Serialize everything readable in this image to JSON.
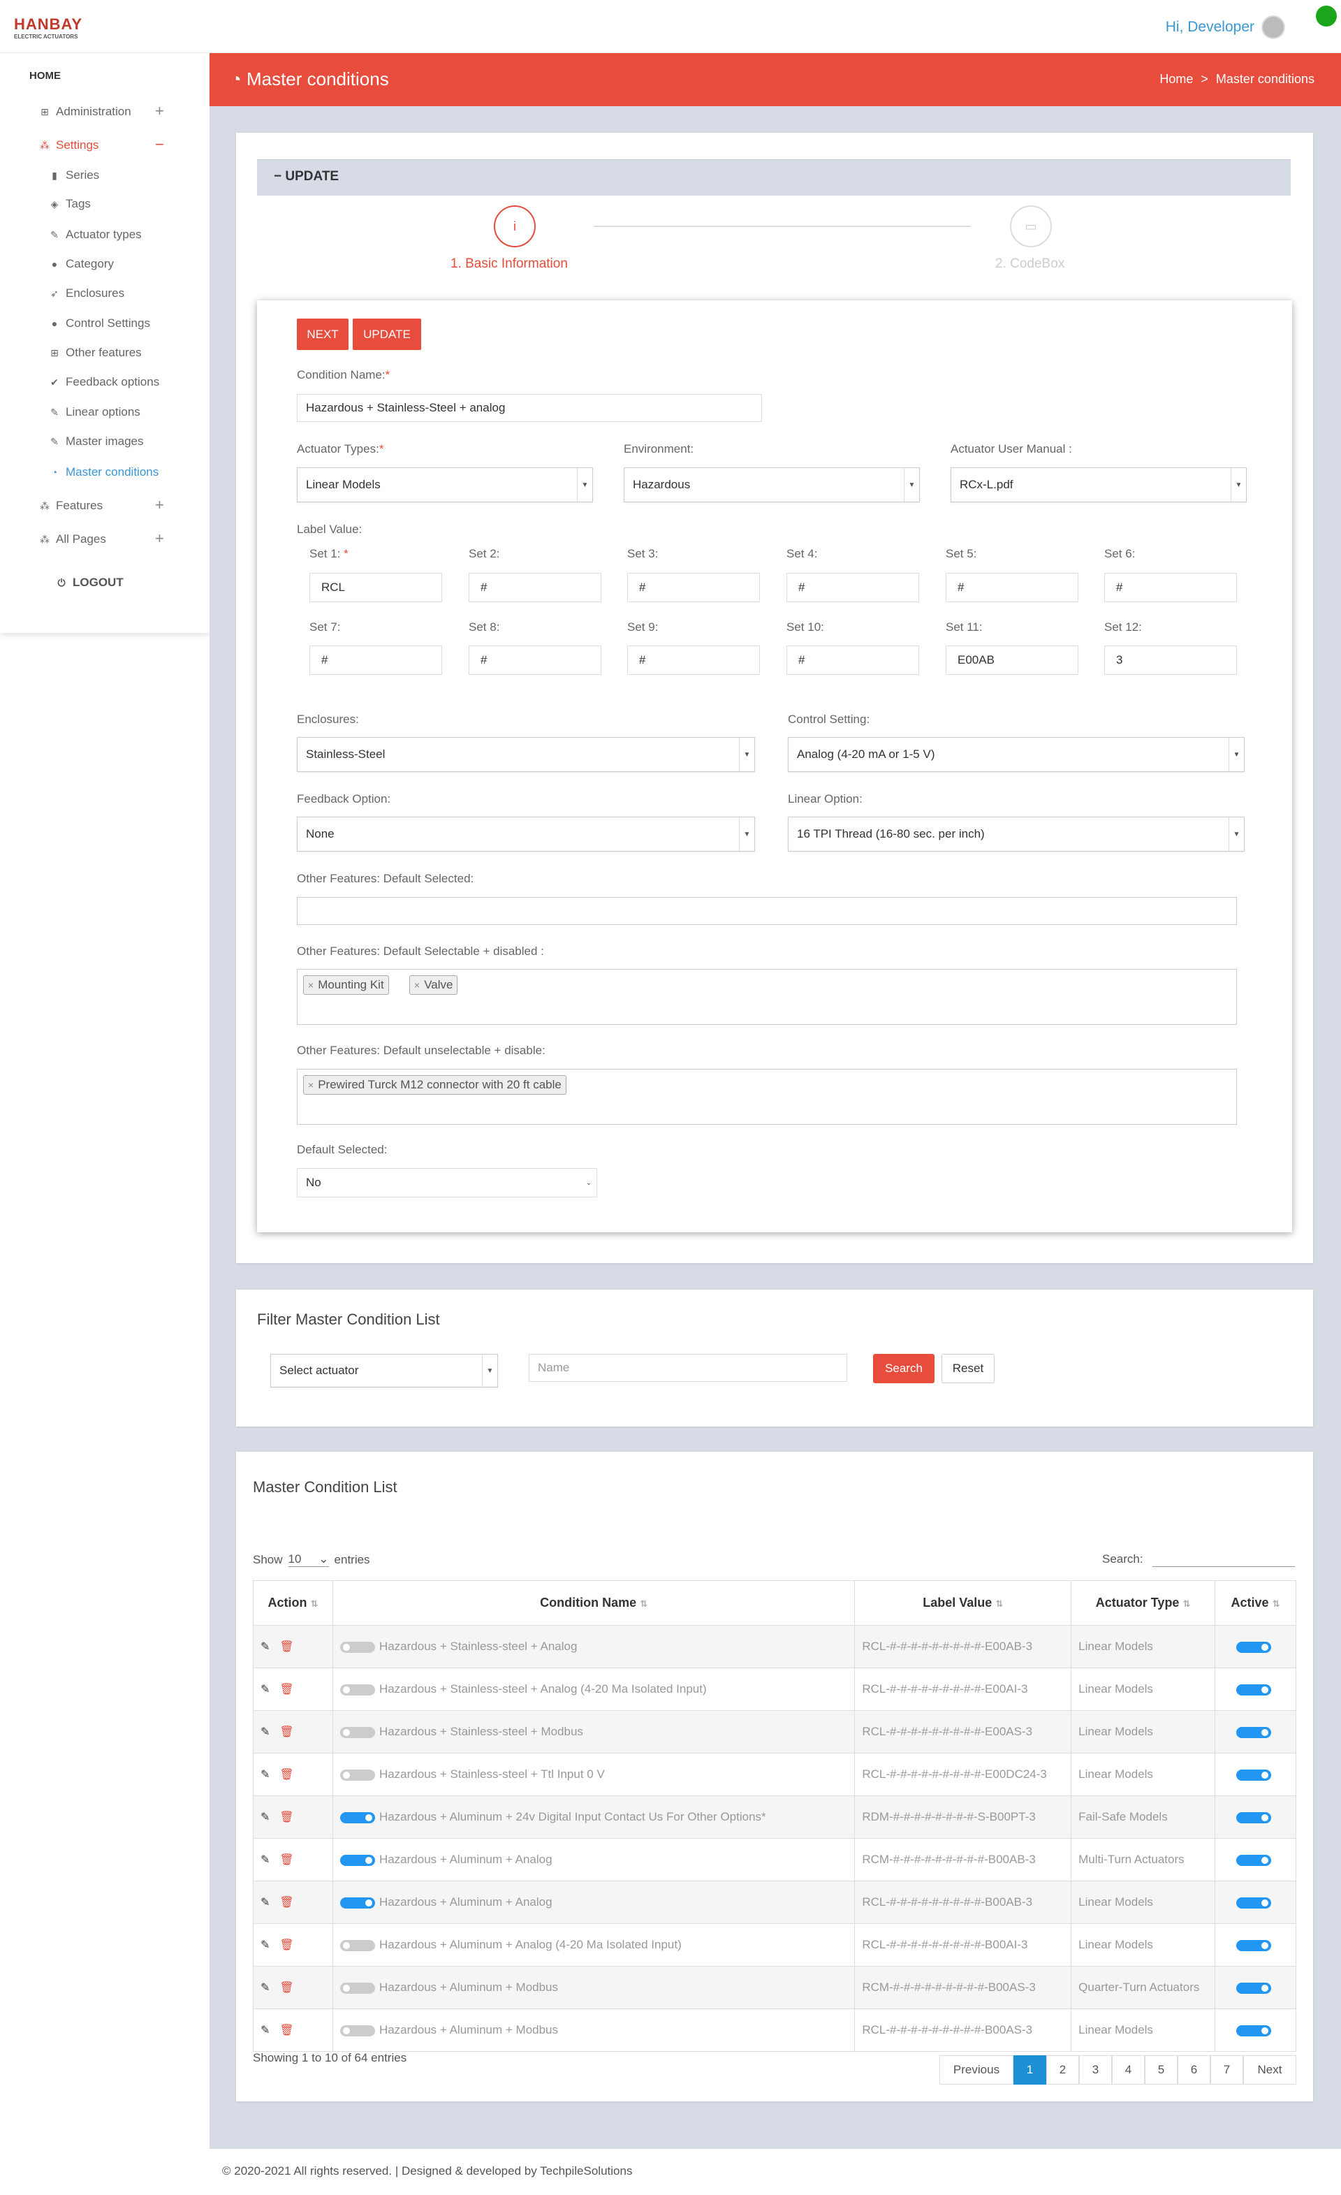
{
  "brand": {
    "name": "HANBAY",
    "tagline": "ELECTRIC ACTUATORS"
  },
  "user": {
    "greeting": "Hi, Developer"
  },
  "sidebar": {
    "home": "HOME",
    "items": [
      {
        "label": "Administration",
        "icon": "plus-square-icon",
        "toggle": "+"
      },
      {
        "label": "Settings",
        "icon": "sitemap-icon",
        "toggle": "−"
      },
      {
        "label": "Series",
        "icon": "book-icon"
      },
      {
        "label": "Tags",
        "icon": "tags-icon"
      },
      {
        "label": "Actuator types",
        "icon": "wrench-icon"
      },
      {
        "label": "Category",
        "icon": "circle-icon"
      },
      {
        "label": "Enclosures",
        "icon": "rocket-icon"
      },
      {
        "label": "Control Settings",
        "icon": "circle-icon"
      },
      {
        "label": "Other features",
        "icon": "plus-square-icon"
      },
      {
        "label": "Feedback options",
        "icon": "check-circle-icon"
      },
      {
        "label": "Linear options",
        "icon": "wrench-icon"
      },
      {
        "label": "Master images",
        "icon": "wrench-icon"
      },
      {
        "label": "Master conditions",
        "icon": "dashboard-icon"
      },
      {
        "label": "Features",
        "icon": "sitemap-icon",
        "toggle": "+"
      },
      {
        "label": "All Pages",
        "icon": "sitemap-icon",
        "toggle": "+"
      }
    ],
    "logout": "LOGOUT"
  },
  "page": {
    "title": "Master conditions",
    "breadcrumb": {
      "home": "Home",
      "sep": ">",
      "current": "Master conditions"
    }
  },
  "update": {
    "header": "UPDATE",
    "collapse": "−",
    "steps": [
      {
        "label": "1. Basic Information",
        "icon": "i"
      },
      {
        "label": "2. CodeBox",
        "icon": "▭"
      }
    ],
    "buttons": {
      "next": "NEXT",
      "update": "UPDATE"
    },
    "form": {
      "condition_name_label": "Condition Name:",
      "condition_name": "Hazardous +  Stainless-Steel + analog",
      "actuator_types_label": "Actuator Types:",
      "actuator_types": "Linear Models",
      "environment_label": "Environment:",
      "environment": "Hazardous",
      "manual_label": "Actuator User Manual :",
      "manual": "RCx-L.pdf",
      "label_value_label": "Label Value:",
      "sets": [
        {
          "label": "Set 1:",
          "value": "RCL",
          "required": true
        },
        {
          "label": "Set 2:",
          "value": "#"
        },
        {
          "label": "Set 3:",
          "value": "#"
        },
        {
          "label": "Set 4:",
          "value": "#"
        },
        {
          "label": "Set 5:",
          "value": "#"
        },
        {
          "label": "Set 6:",
          "value": "#"
        },
        {
          "label": "Set 7:",
          "value": "#"
        },
        {
          "label": "Set 8:",
          "value": "#"
        },
        {
          "label": "Set 9:",
          "value": "#"
        },
        {
          "label": "Set 10:",
          "value": "#"
        },
        {
          "label": "Set 11:",
          "value": "E00AB"
        },
        {
          "label": "Set 12:",
          "value": "3"
        }
      ],
      "enclosures_label": "Enclosures:",
      "enclosures": "Stainless-Steel",
      "control_label": "Control Setting:",
      "control": "Analog (4-20 mA or 1-5 V)",
      "feedback_label": "Feedback Option:",
      "feedback": "None",
      "linear_label": "Linear Option:",
      "linear": "16 TPI Thread (16-80 sec. per inch)",
      "of_default_label": "Other Features: Default Selected:",
      "of_selectable_label": "Other Features: Default Selectable + disabled :",
      "of_selectable_tags": [
        "Mounting Kit",
        "Valve"
      ],
      "of_unselectable_label": "Other Features: Default unselectable + disable:",
      "of_unselectable_tags": [
        "Prewired Turck M12 connector with 20 ft cable"
      ],
      "default_selected_label": "Default Selected:",
      "default_selected": "No"
    }
  },
  "filter": {
    "title": "Filter Master Condition List",
    "actuator_placeholder": "Select actuator",
    "name_placeholder": "Name",
    "search": "Search",
    "reset": "Reset"
  },
  "list": {
    "title": "Master Condition List",
    "show": "Show",
    "entries_value": "10",
    "entries": "entries",
    "search_label": "Search:",
    "columns": {
      "action": "Action",
      "name": "Condition Name",
      "label": "Label Value",
      "type": "Actuator Type",
      "active": "Active"
    },
    "rows": [
      {
        "name": "Hazardous + Stainless-steel + Analog",
        "label": "RCL-#-#-#-#-#-#-#-#-#-E00AB-3",
        "type": "Linear Models",
        "toggle": false
      },
      {
        "name": "Hazardous + Stainless-steel + Analog (4-20 Ma Isolated Input)",
        "label": "RCL-#-#-#-#-#-#-#-#-#-E00AI-3",
        "type": "Linear Models",
        "toggle": false
      },
      {
        "name": "Hazardous + Stainless-steel + Modbus",
        "label": "RCL-#-#-#-#-#-#-#-#-#-E00AS-3",
        "type": "Linear Models",
        "toggle": false
      },
      {
        "name": "Hazardous + Stainless-steel + Ttl Input 0 V",
        "label": "RCL-#-#-#-#-#-#-#-#-#-E00DC24-3",
        "type": "Linear Models",
        "toggle": false
      },
      {
        "name": "Hazardous + Aluminum + 24v Digital Input Contact Us For Other Options*",
        "label": "RDM-#-#-#-#-#-#-#-#-S-B00PT-3",
        "type": "Fail-Safe Models",
        "toggle": true
      },
      {
        "name": "Hazardous + Aluminum + Analog",
        "label": "RCM-#-#-#-#-#-#-#-#-#-B00AB-3",
        "type": "Multi-Turn Actuators",
        "toggle": true
      },
      {
        "name": "Hazardous + Aluminum + Analog",
        "label": "RCL-#-#-#-#-#-#-#-#-#-B00AB-3",
        "type": "Linear Models",
        "toggle": true
      },
      {
        "name": "Hazardous + Aluminum + Analog (4-20 Ma Isolated Input)",
        "label": "RCL-#-#-#-#-#-#-#-#-#-B00AI-3",
        "type": "Linear Models",
        "toggle": false
      },
      {
        "name": "Hazardous + Aluminum + Modbus",
        "label": "RCM-#-#-#-#-#-#-#-#-#-B00AS-3",
        "type": "Quarter-Turn Actuators",
        "toggle": false
      },
      {
        "name": "Hazardous + Aluminum + Modbus",
        "label": "RCL-#-#-#-#-#-#-#-#-#-B00AS-3",
        "type": "Linear Models",
        "toggle": false
      }
    ],
    "info": "Showing 1 to 10 of 64 entries",
    "pagination": {
      "previous": "Previous",
      "pages": [
        "1",
        "2",
        "3",
        "4",
        "5",
        "6",
        "7"
      ],
      "next": "Next",
      "current": "1"
    }
  },
  "footer": "© 2020-2021 All rights reserved. | Designed & developed by TechpileSolutions",
  "colors": {
    "accent": "#e74c3c",
    "link": "#3a97d4",
    "toggle_on": "#2196f3",
    "page_active": "#1e90d6"
  }
}
